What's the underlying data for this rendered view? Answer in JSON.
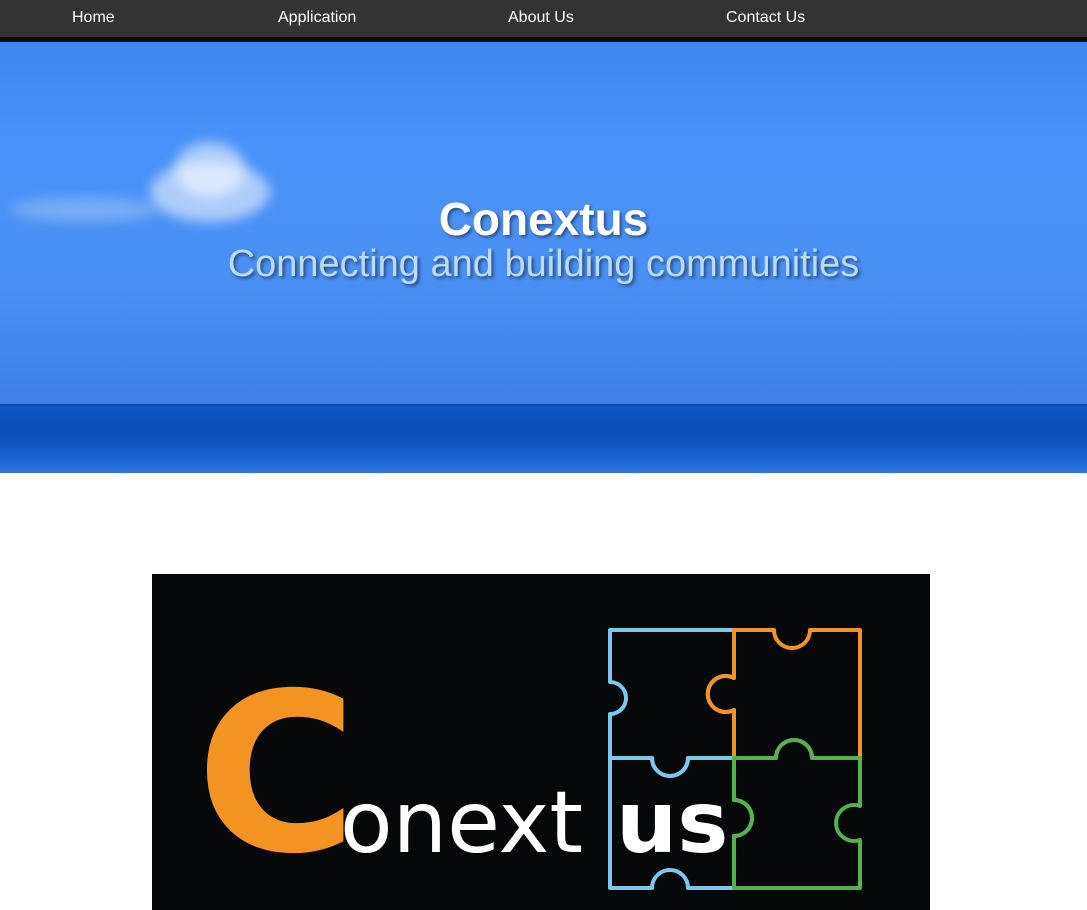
{
  "nav": {
    "items": [
      {
        "label": "Home"
      },
      {
        "label": "Application"
      },
      {
        "label": "About Us"
      },
      {
        "label": "Contact Us"
      }
    ]
  },
  "hero": {
    "title": "Conextus",
    "subtitle": "Connecting and building communities"
  },
  "logo": {
    "letter_c": "C",
    "text_main": "onext",
    "text_bold": "us",
    "colors": {
      "orange": "#f39321",
      "blue": "#7cc7ec",
      "green": "#55b04e",
      "background": "#060708"
    }
  },
  "colors": {
    "navbar": "#333333",
    "sky": "#4a92f8",
    "sea": "#0c4db6"
  }
}
